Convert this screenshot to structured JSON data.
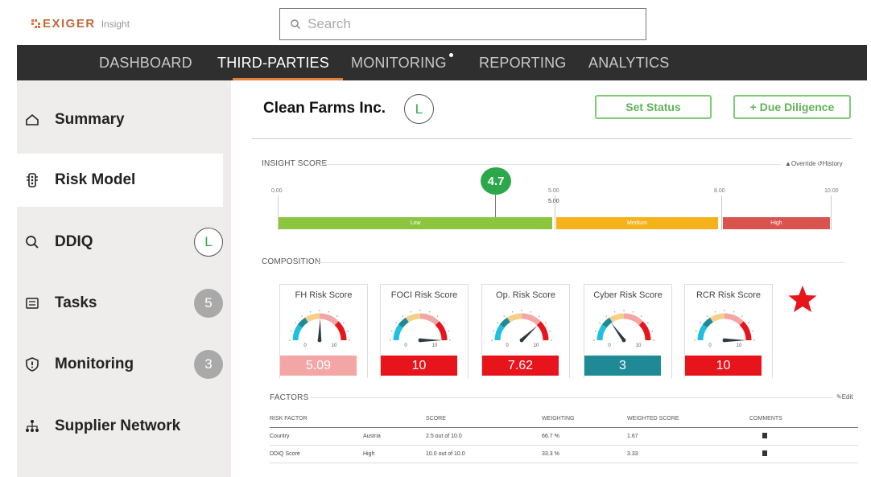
{
  "app": {
    "brand": "EXIGER",
    "brand_sub": "Insight",
    "search_placeholder": "Search"
  },
  "nav": {
    "items": [
      {
        "label": "DASHBOARD",
        "active": false
      },
      {
        "label": "THIRD-PARTIES",
        "active": true
      },
      {
        "label": "MONITORING",
        "active": false
      },
      {
        "label": "REPORTING",
        "active": false
      },
      {
        "label": "ANALYTICS",
        "active": false
      }
    ]
  },
  "sidebar": {
    "items": [
      {
        "label": "Summary",
        "icon": "home-icon"
      },
      {
        "label": "Risk Model",
        "icon": "traffic-light-icon",
        "active": true
      },
      {
        "label": "DDIQ",
        "icon": "search-icon",
        "badge": "L"
      },
      {
        "label": "Tasks",
        "icon": "checklist-icon",
        "badge": "5"
      },
      {
        "label": "Monitoring",
        "icon": "shield-alert-icon",
        "badge": "3"
      },
      {
        "label": "Supplier Network",
        "icon": "network-icon"
      }
    ]
  },
  "header": {
    "company": "Clean Farms Inc.",
    "company_badge": "L",
    "set_status_label": "Set Status",
    "due_diligence_label": "+ Due Diligence"
  },
  "insight_score": {
    "label": "INSIGHT SCORE",
    "override_label": "Override",
    "history_label": "History",
    "score": "4.7",
    "score_value": 4.7,
    "marker_label": "5.00",
    "ticks": [
      "0.00",
      "5.00",
      "8.00",
      "10.00"
    ],
    "bands": [
      {
        "label": "Low",
        "color": "#8cc63f"
      },
      {
        "label": "Medium",
        "color": "#f5b21b"
      },
      {
        "label": "High",
        "color": "#d9534f"
      }
    ]
  },
  "composition": {
    "label": "COMPOSITION",
    "gauges": [
      {
        "title": "FH Risk Score",
        "value": "5.09",
        "value_num": 5.09,
        "color": "#f4a6a6"
      },
      {
        "title": "FOCI Risk Score",
        "value": "10",
        "value_num": 10,
        "color": "#e8141c"
      },
      {
        "title": "Op. Risk Score",
        "value": "7.62",
        "value_num": 7.62,
        "color": "#e8141c"
      },
      {
        "title": "Cyber Risk Score",
        "value": "3",
        "value_num": 3,
        "color": "#1f8a95"
      },
      {
        "title": "RCR Risk Score",
        "value": "10",
        "value_num": 10,
        "color": "#e8141c"
      }
    ],
    "gauge_min": "0",
    "gauge_max": "10"
  },
  "factors": {
    "label": "FACTORS",
    "edit_label": "Edit",
    "columns": [
      "RISK FACTOR",
      "",
      "SCORE",
      "WEIGHTING",
      "WEIGHTED SCORE",
      "COMMENTS"
    ],
    "rows": [
      [
        "Country",
        "Austria",
        "2.5 out of 10.0",
        "66.7 %",
        "1.67"
      ],
      [
        "DDIQ Score",
        "High",
        "10.0 out of 10.0",
        "33.3 %",
        "3.33"
      ]
    ]
  }
}
